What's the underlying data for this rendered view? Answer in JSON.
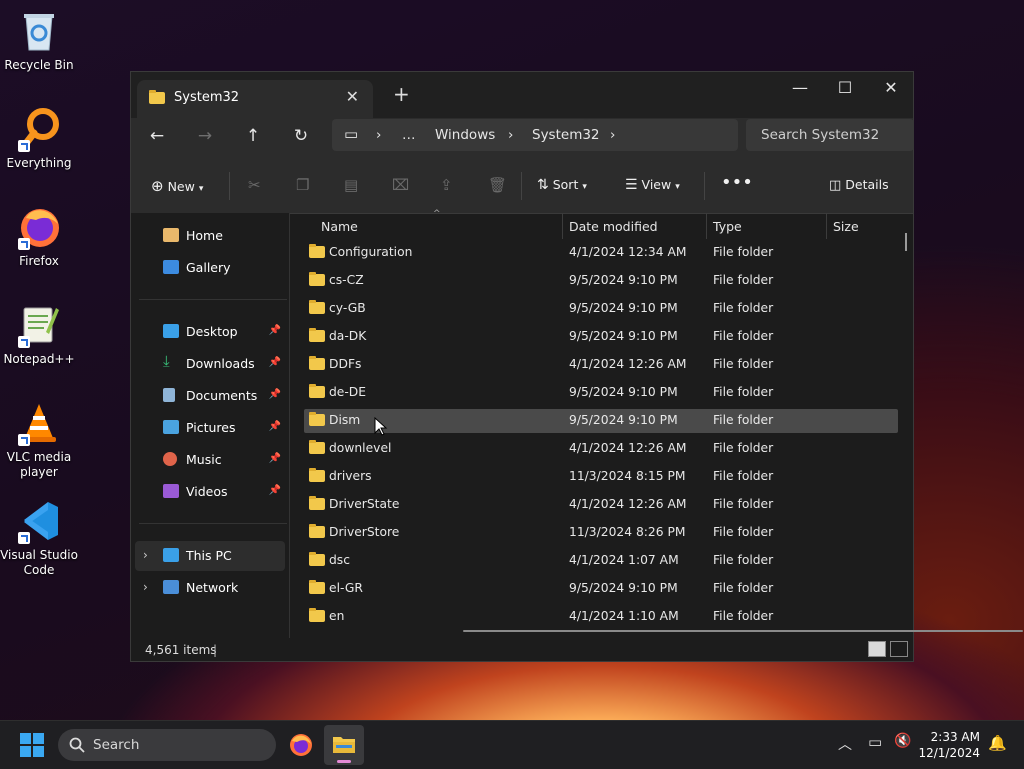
{
  "desktop": {
    "icons": [
      {
        "label": "Recycle Bin"
      },
      {
        "label": "Everything"
      },
      {
        "label": "Firefox"
      },
      {
        "label": "Notepad++"
      },
      {
        "label": "VLC media player"
      },
      {
        "label": "Visual Studio Code"
      }
    ]
  },
  "window": {
    "tab_title": "System32",
    "breadcrumb": [
      "…",
      "Windows",
      "System32"
    ],
    "search_placeholder": "Search System32",
    "commands": {
      "new": "New",
      "sort": "Sort",
      "view": "View",
      "details": "Details"
    },
    "sidebar": {
      "top": [
        {
          "label": "Home"
        },
        {
          "label": "Gallery"
        }
      ],
      "pinned": [
        {
          "label": "Desktop"
        },
        {
          "label": "Downloads"
        },
        {
          "label": "Documents"
        },
        {
          "label": "Pictures"
        },
        {
          "label": "Music"
        },
        {
          "label": "Videos"
        }
      ],
      "bottom": [
        {
          "label": "This PC"
        },
        {
          "label": "Network"
        }
      ]
    },
    "columns": {
      "name": "Name",
      "date": "Date modified",
      "type": "Type",
      "size": "Size"
    },
    "files": [
      {
        "name": "Configuration",
        "date": "4/1/2024 12:34 AM",
        "type": "File folder"
      },
      {
        "name": "cs-CZ",
        "date": "9/5/2024 9:10 PM",
        "type": "File folder"
      },
      {
        "name": "cy-GB",
        "date": "9/5/2024 9:10 PM",
        "type": "File folder"
      },
      {
        "name": "da-DK",
        "date": "9/5/2024 9:10 PM",
        "type": "File folder"
      },
      {
        "name": "DDFs",
        "date": "4/1/2024 12:26 AM",
        "type": "File folder"
      },
      {
        "name": "de-DE",
        "date": "9/5/2024 9:10 PM",
        "type": "File folder"
      },
      {
        "name": "Dism",
        "date": "9/5/2024 9:10 PM",
        "type": "File folder"
      },
      {
        "name": "downlevel",
        "date": "4/1/2024 12:26 AM",
        "type": "File folder"
      },
      {
        "name": "drivers",
        "date": "11/3/2024 8:15 PM",
        "type": "File folder"
      },
      {
        "name": "DriverState",
        "date": "4/1/2024 12:26 AM",
        "type": "File folder"
      },
      {
        "name": "DriverStore",
        "date": "11/3/2024 8:26 PM",
        "type": "File folder"
      },
      {
        "name": "dsc",
        "date": "4/1/2024 1:07 AM",
        "type": "File folder"
      },
      {
        "name": "el-GR",
        "date": "9/5/2024 9:10 PM",
        "type": "File folder"
      },
      {
        "name": "en",
        "date": "4/1/2024 1:10 AM",
        "type": "File folder"
      }
    ],
    "status_count": "4,561 items"
  },
  "taskbar": {
    "search_label": "Search",
    "time": "2:33 AM",
    "date": "12/1/2024"
  },
  "colors": {
    "accent": "#0078d4",
    "folder": "#f2c84b",
    "window_bg": "#1c1c1c",
    "highlight": "#4a4a4a"
  }
}
